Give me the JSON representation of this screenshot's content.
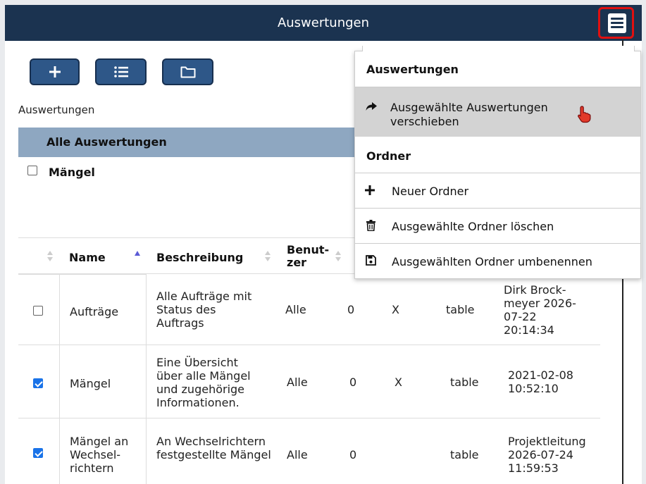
{
  "titlebar": {
    "title": "Auswertungen",
    "menu_icon": "hamburger-icon"
  },
  "toolbar": {
    "add_icon": "plus-icon",
    "list_icon": "list-icon",
    "folder_icon": "folder-icon"
  },
  "breadcrumb": "Auswertungen",
  "folders": {
    "all_label": "Alle Auswertungen",
    "items": [
      {
        "label": "Mängel",
        "checked": false
      }
    ]
  },
  "table": {
    "headers": {
      "name": "Name",
      "description": "Beschreibung",
      "user": "Benut-\nzer"
    },
    "rows": [
      {
        "checked": false,
        "name": "Aufträge",
        "description": "Alle Aufträge mit Status des Auftrags",
        "scope": "Alle",
        "count": "0",
        "flag": "X",
        "type": "table",
        "modified": "Dirk Brock-meyer 2026-07-22 20:14:34"
      },
      {
        "checked": true,
        "name": "Mängel",
        "description": "Eine Übersicht über alle Mängel und zugehörige Informationen.",
        "scope": "Alle",
        "count": "0",
        "flag": "X",
        "type": "table",
        "modified": "2021-02-08 10:52:10"
      },
      {
        "checked": true,
        "name": "Mängel an Wechsel-richtern",
        "description": "An Wechselrichtern festgestellte Mängel",
        "scope": "Alle",
        "count": "0",
        "flag": "",
        "type": "table",
        "modified": "Projektleitung 2026-07-24 11:59:53"
      }
    ]
  },
  "dropdown": {
    "section1": "Auswertungen",
    "move_item": "Ausgewählte Auswertungen verschieben",
    "section2": "Ordner",
    "new_folder": "Neuer Ordner",
    "delete_folders": "Ausgewählte Ordner löschen",
    "rename_folder": "Ausgewählten Ordner umbenennen"
  },
  "colors": {
    "titlebar": "#1b3350",
    "button": "#2e5788",
    "folderbar": "#8ea7c1",
    "highlight": "#d3d3d3",
    "check": "#1a73e8",
    "menu_outline": "#e01010"
  }
}
